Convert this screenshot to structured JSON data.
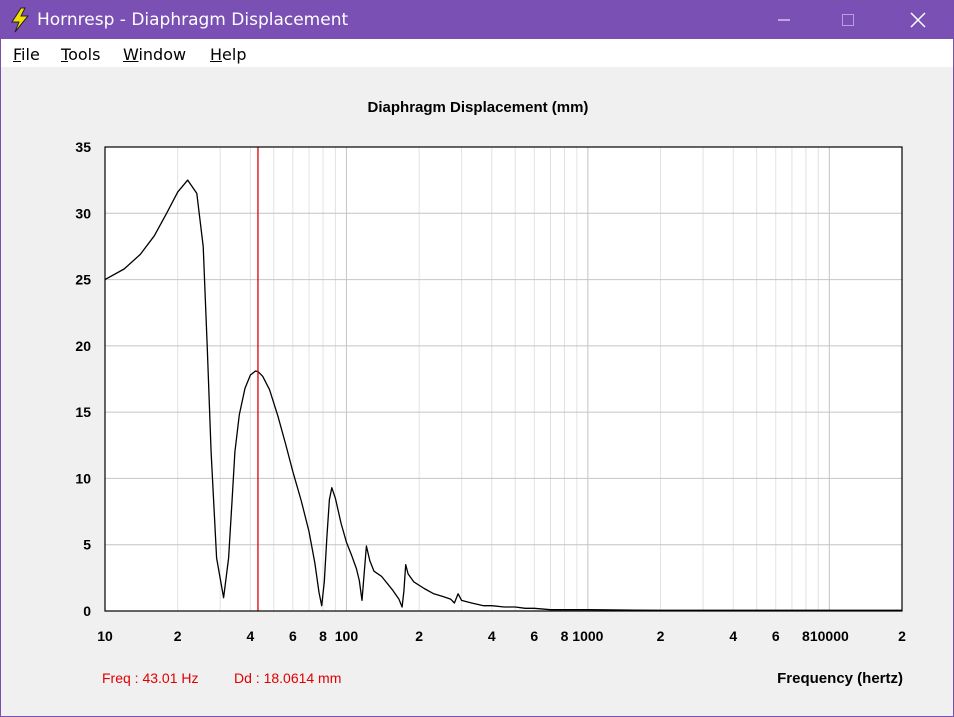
{
  "window": {
    "title": "Hornresp - Diaphragm Displacement",
    "accent": "#7a50b5"
  },
  "menu": {
    "items": [
      {
        "label": "File",
        "mnemonic": "F"
      },
      {
        "label": "Tools",
        "mnemonic": "T"
      },
      {
        "label": "Window",
        "mnemonic": "W"
      },
      {
        "label": "Help",
        "mnemonic": "H"
      }
    ]
  },
  "readout": {
    "freq": "Freq : 43.01 Hz",
    "dd": "Dd : 18.0614 mm"
  },
  "chart_data": {
    "type": "line",
    "title": "Diaphragm Displacement (mm)",
    "xlabel": "Frequency (hertz)",
    "ylabel": "",
    "xscale": "log",
    "xlim": [
      10,
      20000
    ],
    "ylim": [
      0,
      35
    ],
    "yticks": [
      0,
      5,
      10,
      15,
      20,
      25,
      30,
      35
    ],
    "xtick_labels": [
      {
        "x": 10,
        "label": "10"
      },
      {
        "x": 20,
        "label": "2"
      },
      {
        "x": 40,
        "label": "4"
      },
      {
        "x": 60,
        "label": "6"
      },
      {
        "x": 80,
        "label": "8"
      },
      {
        "x": 100,
        "label": "100"
      },
      {
        "x": 200,
        "label": "2"
      },
      {
        "x": 400,
        "label": "4"
      },
      {
        "x": 600,
        "label": "6"
      },
      {
        "x": 800,
        "label": "8"
      },
      {
        "x": 1000,
        "label": "1000"
      },
      {
        "x": 2000,
        "label": "2"
      },
      {
        "x": 4000,
        "label": "4"
      },
      {
        "x": 6000,
        "label": "6"
      },
      {
        "x": 8000,
        "label": "8"
      },
      {
        "x": 10000,
        "label": "10000"
      },
      {
        "x": 20000,
        "label": "2"
      }
    ],
    "grid": true,
    "cursor_x": 43.01,
    "cursor_color": "#e00000",
    "series": [
      {
        "color": "#000000",
        "x": [
          10,
          12,
          14,
          16,
          18,
          20,
          22,
          24,
          25.5,
          26.5,
          27.5,
          29,
          31,
          32.5,
          33.5,
          34.5,
          36,
          38,
          40,
          42,
          43.01,
          45,
          48,
          52,
          56,
          60,
          65,
          70,
          74,
          77,
          79,
          81,
          83,
          85,
          87,
          90,
          95,
          100,
          105,
          110,
          113,
          116,
          118,
          121,
          125,
          130,
          140,
          155,
          165,
          170,
          173,
          176,
          180,
          190,
          210,
          230,
          250,
          270,
          280,
          290,
          300,
          330,
          370,
          400,
          450,
          500,
          550,
          600,
          700,
          1000,
          2000,
          5000,
          10000,
          20000
        ],
        "y": [
          25.0,
          25.8,
          26.9,
          28.3,
          30.0,
          31.6,
          32.5,
          31.5,
          27.5,
          20.0,
          12.0,
          4.0,
          1.0,
          4.0,
          8.0,
          12.0,
          14.8,
          16.8,
          17.8,
          18.1,
          18.06,
          17.7,
          16.7,
          14.7,
          12.6,
          10.5,
          8.3,
          6.0,
          3.6,
          1.4,
          0.4,
          2.2,
          5.6,
          8.4,
          9.3,
          8.5,
          6.6,
          5.2,
          4.2,
          3.2,
          2.3,
          0.8,
          2.5,
          4.9,
          3.8,
          3.0,
          2.6,
          1.6,
          0.9,
          0.3,
          1.5,
          3.5,
          2.8,
          2.2,
          1.7,
          1.3,
          1.1,
          0.9,
          0.6,
          1.3,
          0.8,
          0.6,
          0.4,
          0.4,
          0.3,
          0.3,
          0.2,
          0.2,
          0.1,
          0.1,
          0.05,
          0.05,
          0.05,
          0.05
        ]
      }
    ]
  }
}
